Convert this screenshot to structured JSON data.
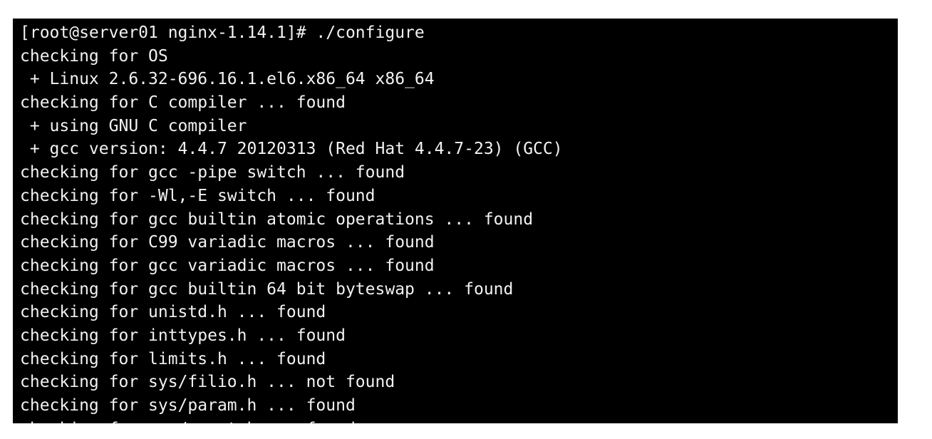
{
  "terminal": {
    "lines": [
      "[root@server01 nginx-1.14.1]# ./configure",
      "checking for OS",
      " + Linux 2.6.32-696.16.1.el6.x86_64 x86_64",
      "checking for C compiler ... found",
      " + using GNU C compiler",
      " + gcc version: 4.4.7 20120313 (Red Hat 4.4.7-23) (GCC)",
      "checking for gcc -pipe switch ... found",
      "checking for -Wl,-E switch ... found",
      "checking for gcc builtin atomic operations ... found",
      "checking for C99 variadic macros ... found",
      "checking for gcc variadic macros ... found",
      "checking for gcc builtin 64 bit byteswap ... found",
      "checking for unistd.h ... found",
      "checking for inttypes.h ... found",
      "checking for limits.h ... found",
      "checking for sys/filio.h ... not found",
      "checking for sys/param.h ... found",
      "checking for sys/mount.h ... found"
    ]
  },
  "colors": {
    "background": "#000000",
    "foreground": "#f2f2f2",
    "page": "#ffffff"
  }
}
